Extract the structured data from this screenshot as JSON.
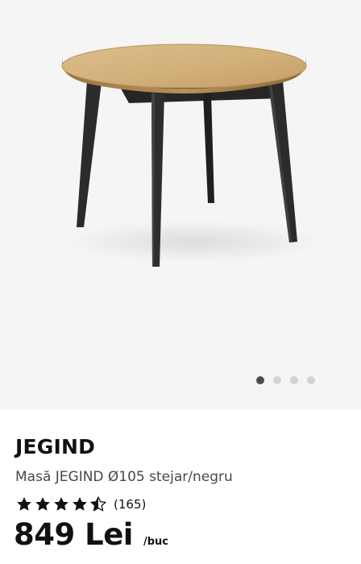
{
  "gallery": {
    "image_alt": "Masă JEGIND Ø105 stejar/negru",
    "pagination": {
      "total": 4,
      "active": 1
    }
  },
  "product": {
    "brand": "JEGIND",
    "description": "Masă JEGIND Ø105 stejar/negru",
    "rating": {
      "value": 4.5,
      "max": 5,
      "review_count": "(165)"
    },
    "price": "849 Lei",
    "unit": "/buc"
  },
  "colors": {
    "gallery_bg": "#f5f5f5",
    "tabletop": "#d2b07a",
    "legs": "#2b2b2b",
    "text": "#111111",
    "dot_active": "#4b4b4b",
    "dot_inactive": "#d3d3d3"
  },
  "icons": [
    "star-icon",
    "half-star-icon",
    "empty-star-icon"
  ]
}
